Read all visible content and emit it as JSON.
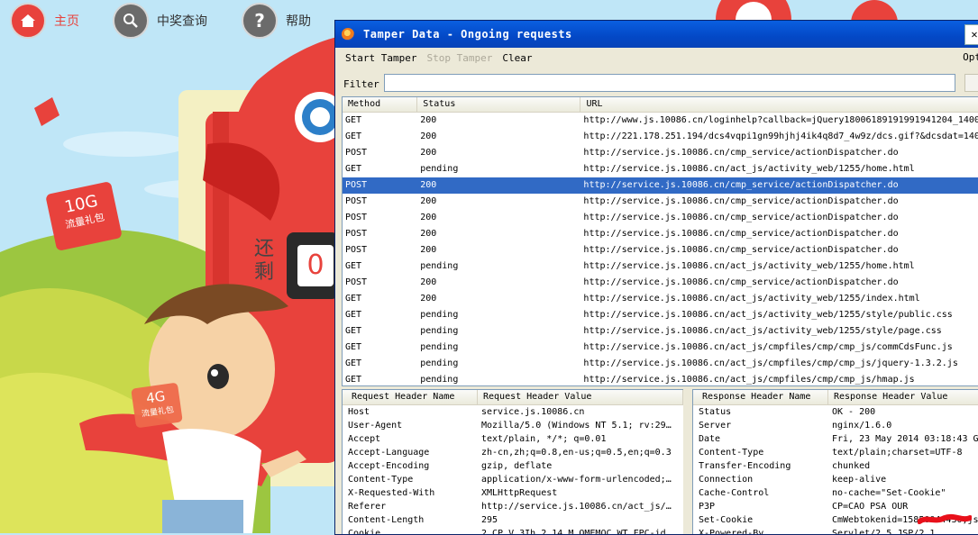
{
  "site_nav": {
    "home_label": "主页",
    "lottery_label": "中奖查询",
    "help_label": "帮助"
  },
  "promo": {
    "gift_10g_size": "10G",
    "gift_10g_text": "流量礼包",
    "gift_4g_size": "4G",
    "gift_4g_text": "流量礼包",
    "remaining_label": "还剩",
    "counter_digit": "0"
  },
  "tamper_window": {
    "title": "Tamper Data - Ongoing requests",
    "close_glyph": "✕",
    "menu": {
      "start": "Start Tamper",
      "stop": "Stop Tamper",
      "clear": "Clear",
      "options": "Opt"
    },
    "filter_label": "Filter",
    "filter_value": "",
    "columns": [
      "Method",
      "Status",
      "URL"
    ],
    "requests": [
      {
        "method": "GET",
        "status": "200",
        "url": "http://www.js.10086.cn/loginhelp?callback=jQuery18006189191991941204_1400"
      },
      {
        "method": "GET",
        "status": "200",
        "url": "http://221.178.251.194/dcs4vqpi1gn99hjhj4ik4q8d7_4w9z/dcs.gif?&dcsdat=140"
      },
      {
        "method": "POST",
        "status": "200",
        "url": "http://service.js.10086.cn/cmp_service/actionDispatcher.do"
      },
      {
        "method": "GET",
        "status": "pending",
        "url": "http://service.js.10086.cn/act_js/activity_web/1255/home.html"
      },
      {
        "method": "POST",
        "status": "200",
        "url": "http://service.js.10086.cn/cmp_service/actionDispatcher.do",
        "selected": true
      },
      {
        "method": "POST",
        "status": "200",
        "url": "http://service.js.10086.cn/cmp_service/actionDispatcher.do"
      },
      {
        "method": "POST",
        "status": "200",
        "url": "http://service.js.10086.cn/cmp_service/actionDispatcher.do"
      },
      {
        "method": "POST",
        "status": "200",
        "url": "http://service.js.10086.cn/cmp_service/actionDispatcher.do"
      },
      {
        "method": "POST",
        "status": "200",
        "url": "http://service.js.10086.cn/cmp_service/actionDispatcher.do"
      },
      {
        "method": "GET",
        "status": "pending",
        "url": "http://service.js.10086.cn/act_js/activity_web/1255/home.html"
      },
      {
        "method": "POST",
        "status": "200",
        "url": "http://service.js.10086.cn/cmp_service/actionDispatcher.do"
      },
      {
        "method": "GET",
        "status": "200",
        "url": "http://service.js.10086.cn/act_js/activity_web/1255/index.html"
      },
      {
        "method": "GET",
        "status": "pending",
        "url": "http://service.js.10086.cn/act_js/activity_web/1255/style/public.css"
      },
      {
        "method": "GET",
        "status": "pending",
        "url": "http://service.js.10086.cn/act_js/activity_web/1255/style/page.css"
      },
      {
        "method": "GET",
        "status": "pending",
        "url": "http://service.js.10086.cn/act_js/cmpfiles/cmp/cmp_js/commCdsFunc.js"
      },
      {
        "method": "GET",
        "status": "pending",
        "url": "http://service.js.10086.cn/act_js/cmpfiles/cmp/cmp_js/jquery-1.3.2.js"
      },
      {
        "method": "GET",
        "status": "pending",
        "url": "http://service.js.10086.cn/act_js/cmpfiles/cmp/cmp_js/hmap.js"
      }
    ],
    "request_headers": {
      "columns": [
        "Request Header Name",
        "Request Header Value"
      ],
      "rows": [
        {
          "name": "Host",
          "value": "service.js.10086.cn"
        },
        {
          "name": "User-Agent",
          "value": "Mozilla/5.0 (Windows NT 5.1; rv:29…"
        },
        {
          "name": "Accept",
          "value": "text/plain, */*; q=0.01"
        },
        {
          "name": "Accept-Language",
          "value": "zh-cn,zh;q=0.8,en-us;q=0.5,en;q=0.3"
        },
        {
          "name": "Accept-Encoding",
          "value": "gzip, deflate"
        },
        {
          "name": "Content-Type",
          "value": "application/x-www-form-urlencoded;…"
        },
        {
          "name": "X-Requested-With",
          "value": "XMLHttpRequest"
        },
        {
          "name": "Referer",
          "value": "http://service.js.10086.cn/act_js/…"
        },
        {
          "name": "Content-Length",
          "value": "295"
        },
        {
          "name": "Cookie",
          "value": "2_CP_V_3Ih_2_14_M_OMEMOC_WT_FPC-id…"
        }
      ]
    },
    "response_headers": {
      "columns": [
        "Response Header Name",
        "Response Header Value"
      ],
      "rows": [
        {
          "name": "Status",
          "value": "OK - 200"
        },
        {
          "name": "Server",
          "value": "nginx/1.6.0"
        },
        {
          "name": "Date",
          "value": "Fri, 23 May 2014 03:18:43 G"
        },
        {
          "name": "Content-Type",
          "value": "text/plain;charset=UTF-8"
        },
        {
          "name": "Transfer-Encoding",
          "value": "chunked"
        },
        {
          "name": "Connection",
          "value": "keep-alive"
        },
        {
          "name": "Cache-Control",
          "value": "no-cache=\"Set-Cookie\""
        },
        {
          "name": "P3P",
          "value": "CP=CAO PSA OUR"
        },
        {
          "name": "Set-Cookie",
          "value": "CmWebtokenid=15850044430;js"
        },
        {
          "name": "X-Powered-By",
          "value": "Servlet/2.5 JSP/2.1"
        }
      ]
    }
  }
}
